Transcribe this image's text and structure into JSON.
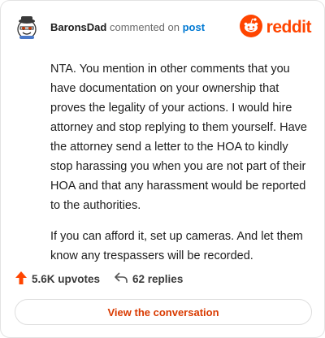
{
  "header": {
    "username": "BaronsDad",
    "action_text": "commented on",
    "post_link": "post"
  },
  "brand": {
    "name": "reddit",
    "logo_icon": "reddit-snoo-icon",
    "color": "#ff4500"
  },
  "comment": {
    "paragraphs": [
      "NTA. You mention in other comments that you have documentation on your ownership that proves the legality of your actions. I would hire attorney and stop replying to them yourself. Have the attorney send a letter to the HOA to kindly stop harassing you when you are not part of their HOA and that any harassment would be reported to the authorities.",
      "If you can afford it, set up cameras. And let them know any trespassers will be recorded."
    ]
  },
  "stats": {
    "upvotes": "5.6K upvotes",
    "replies": "62 replies",
    "upvote_icon": "upvote-arrow-icon",
    "reply_icon": "reply-arrow-icon"
  },
  "cta": {
    "label": "View the conversation",
    "color": "#d93a00"
  }
}
